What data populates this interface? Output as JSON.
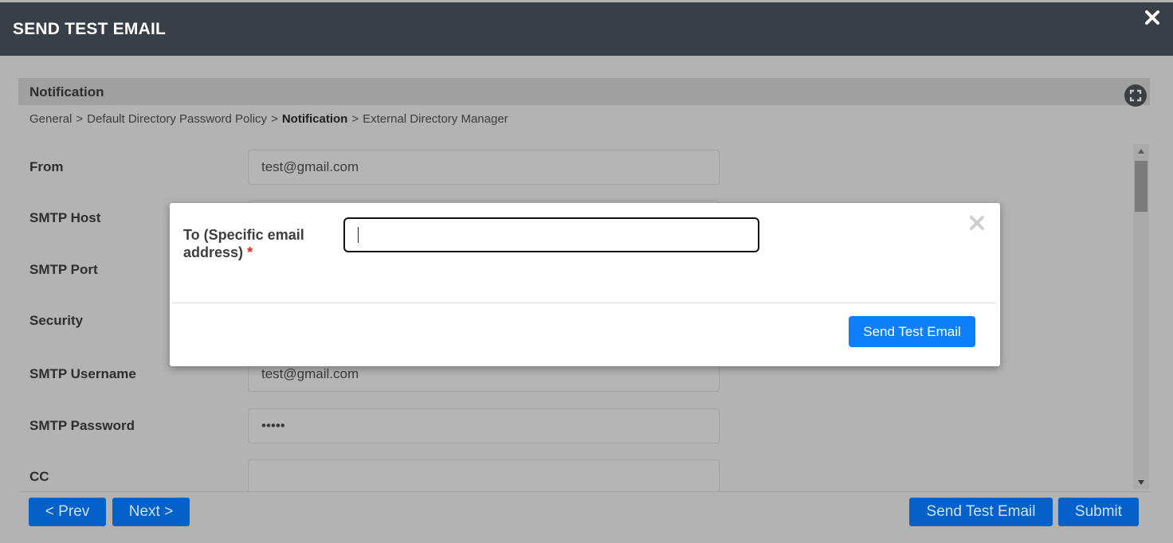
{
  "window": {
    "title": "SEND TEST EMAIL"
  },
  "section": {
    "title": "Notification"
  },
  "breadcrumb": {
    "items": [
      "General",
      "Default Directory Password Policy",
      "Notification",
      "External Directory Manager"
    ],
    "separator": ">"
  },
  "form": {
    "fields": [
      {
        "label": "From",
        "value": "test@gmail.com"
      },
      {
        "label": "SMTP Host",
        "value": ""
      },
      {
        "label": "SMTP Port",
        "value": ""
      },
      {
        "label": "Security",
        "value": ""
      },
      {
        "label": "SMTP Username",
        "value": "test@gmail.com"
      },
      {
        "label": "SMTP Password",
        "value": "•••••"
      },
      {
        "label": "CC",
        "value": ""
      }
    ]
  },
  "footer": {
    "prev_label": "< Prev",
    "next_label": "Next >",
    "send_test_label": "Send Test Email",
    "submit_label": "Submit"
  },
  "modal": {
    "label": "To (Specific email address)",
    "required_mark": "*",
    "input_value": "",
    "send_label": "Send Test Email"
  },
  "colors": {
    "header_bg": "#393f47",
    "primary_button": "#0d7ff8",
    "overlay_button": "#0560c8",
    "required": "#e0261f"
  },
  "icons": {
    "window_close": "close-icon",
    "expand": "fullscreen-icon",
    "modal_close": "close-icon",
    "scroll_up": "arrow-up-icon",
    "scroll_down": "arrow-down-icon"
  }
}
